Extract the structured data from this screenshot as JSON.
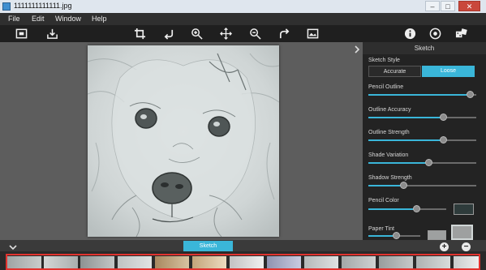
{
  "window": {
    "title": "1111111111111.jpg",
    "minimize": "–",
    "maximize": "□",
    "close": "✕"
  },
  "menu": [
    "File",
    "Edit",
    "Window",
    "Help"
  ],
  "toolbar": {
    "left": [
      "fit-screen-icon",
      "save-icon"
    ],
    "center": [
      "crop-icon",
      "undo-icon",
      "zoom-in-icon",
      "move-icon",
      "zoom-out-icon",
      "redo-icon",
      "compare-icon"
    ],
    "right": [
      "info-icon",
      "settings-icon",
      "effects-icon"
    ]
  },
  "panel": {
    "header": "Sketch",
    "style_label": "Sketch Style",
    "style_options": [
      "Accurate",
      "Loose"
    ],
    "style_selected": "Loose",
    "accent_color": "#3ab6d9",
    "sliders": [
      {
        "label": "Pencil Outline",
        "value": 0.94
      },
      {
        "label": "Outline Accuracy",
        "value": 0.69
      },
      {
        "label": "Outline Strength",
        "value": 0.69
      },
      {
        "label": "Shade Variation",
        "value": 0.56
      },
      {
        "label": "Shadow Strength",
        "value": 0.32
      },
      {
        "label": "Pencil Color",
        "value": 0.61
      },
      {
        "label": "Paper Tint",
        "value": 0.53
      }
    ],
    "pencil_color_swatch": "#2e3b3b",
    "paper_tint_swatch": "#9ea0a0"
  },
  "bottom": {
    "active_tab": "Sketch",
    "add": "+",
    "remove": "−"
  }
}
